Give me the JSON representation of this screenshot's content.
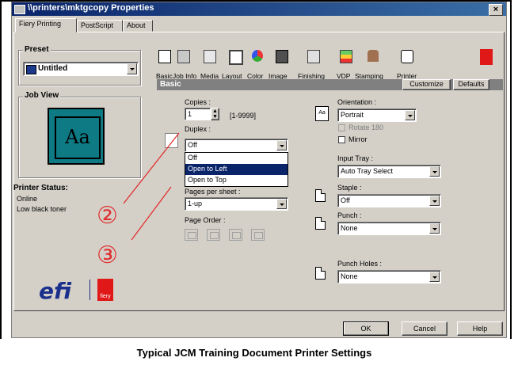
{
  "window": {
    "title": "\\\\printers\\mktgcopy Properties",
    "close_glyph": "×"
  },
  "tabs": [
    "Fiery Printing",
    "PostScript",
    "About"
  ],
  "preset": {
    "label": "Preset",
    "value": "Untitled"
  },
  "job_view": {
    "label": "Job View",
    "sample": "Aa"
  },
  "printer_status": {
    "label": "Printer Status:",
    "lines": [
      "Online",
      "Low black toner"
    ]
  },
  "brand": {
    "logo": "efi",
    "fiery": "fiery"
  },
  "toolbar": [
    "Basic",
    "Job Info",
    "Media",
    "Layout",
    "Color",
    "Image",
    "Finishing",
    "VDP",
    "Stamping",
    "Printer"
  ],
  "section": {
    "title": "Basic",
    "customize": "Customize",
    "defaults": "Defaults"
  },
  "copies": {
    "label": "Copies :",
    "value": "1",
    "range": "[1-9999]"
  },
  "duplex": {
    "label": "Duplex :",
    "value": "Off",
    "options": [
      "Off",
      "Open to Left",
      "Open to Top"
    ],
    "highlighted": 1
  },
  "pages_per_sheet": {
    "label": "Pages per sheet :",
    "value": "1-up"
  },
  "page_order": {
    "label": "Page Order :"
  },
  "orientation": {
    "label": "Orientation :",
    "value": "Portrait",
    "rotate": "Rotate 180",
    "mirror": "Mirror"
  },
  "input_tray": {
    "label": "Input Tray :",
    "value": "Auto Tray Select"
  },
  "staple": {
    "label": "Staple :",
    "value": "Off"
  },
  "punch": {
    "label": "Punch :",
    "value": "None"
  },
  "punch_holes": {
    "label": "Punch Holes :",
    "value": "None"
  },
  "buttons": {
    "ok": "OK",
    "cancel": "Cancel",
    "help": "Help"
  },
  "annotations": [
    "②",
    "③"
  ],
  "annotation_color": "#e03030",
  "caption": "Typical JCM Training Document Printer Settings"
}
